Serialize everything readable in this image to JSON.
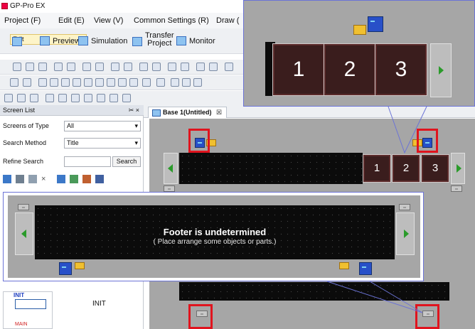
{
  "app": {
    "title": "GP-Pro EX"
  },
  "menu": [
    "Project (F)",
    "Edit (E)",
    "View (V)",
    "Common Settings (R)",
    "Draw ("
  ],
  "toolbar": {
    "edit": "Edit",
    "preview": "Preview",
    "simulation": "Simulation",
    "transfer_line1": "Transfer",
    "transfer_line2": "Project",
    "monitor": "Monitor"
  },
  "screen_list": {
    "title": "Screen List",
    "pin_close": "✂ ×",
    "screens_of_type_label": "Screens of Type",
    "screens_of_type_value": "All",
    "search_method_label": "Search Method",
    "search_method_value": "Title",
    "refine_search_label": "Refine Search",
    "search_button": "Search"
  },
  "editor": {
    "tab_label": "Base 1(Untitled)",
    "tab_close": "☒"
  },
  "numkeys": [
    "1",
    "2",
    "3"
  ],
  "footer": {
    "title": "Footer is undetermined",
    "subtitle": "( Place arrange some objects or parts.)"
  },
  "init": {
    "tag": "INIT",
    "label": "INIT",
    "main_tag": "MAIN"
  },
  "colors": {
    "highlight_red": "#e0141e",
    "callout_blue": "#6b73d6",
    "key_maroon": "#3a1d1d"
  }
}
